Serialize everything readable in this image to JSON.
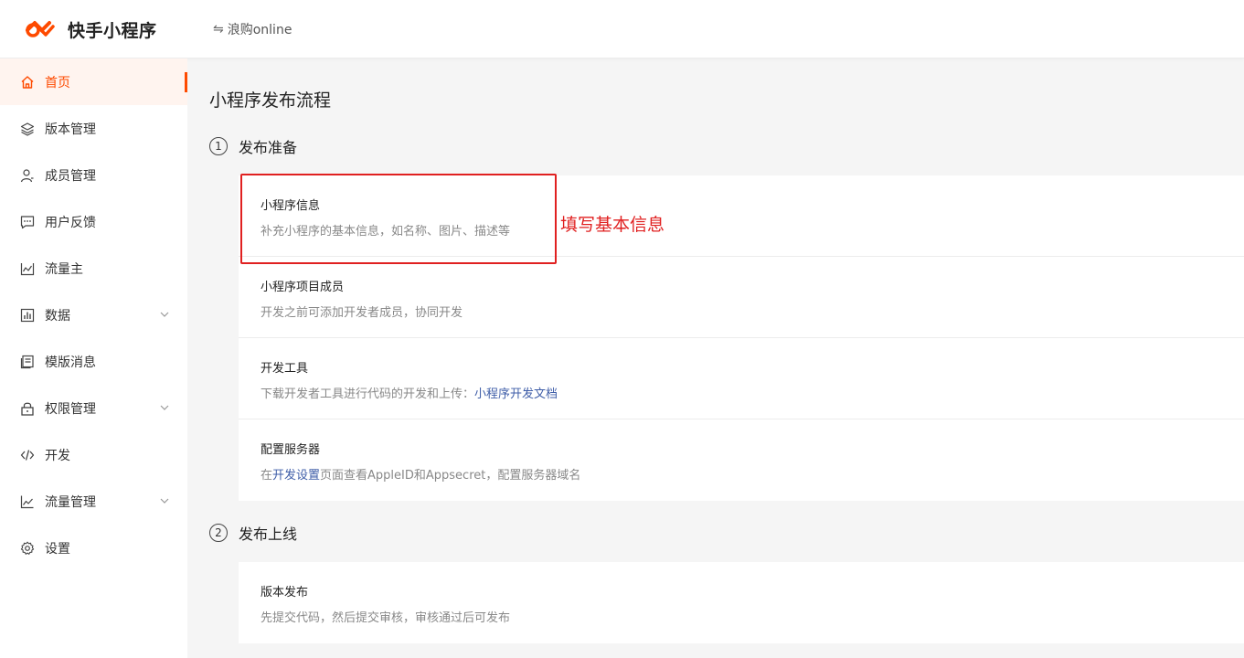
{
  "header": {
    "brand": "快手小程序",
    "app_name": "浪购online",
    "swap_icon": "⇋",
    "brand_color": "#fe4a00"
  },
  "sidebar": {
    "items": [
      {
        "label": "首页",
        "icon": "home-icon",
        "active": true
      },
      {
        "label": "版本管理",
        "icon": "layers-icon"
      },
      {
        "label": "成员管理",
        "icon": "user-icon"
      },
      {
        "label": "用户反馈",
        "icon": "message-icon"
      },
      {
        "label": "流量主",
        "icon": "traffic-icon"
      },
      {
        "label": "数据",
        "icon": "bar-chart-icon",
        "expandable": true
      },
      {
        "label": "模版消息",
        "icon": "document-icon"
      },
      {
        "label": "权限管理",
        "icon": "lock-icon",
        "expandable": true
      },
      {
        "label": "开发",
        "icon": "code-icon"
      },
      {
        "label": "流量管理",
        "icon": "line-chart-icon",
        "expandable": true
      },
      {
        "label": "设置",
        "icon": "gear-icon"
      }
    ]
  },
  "main": {
    "title": "小程序发布流程",
    "steps": [
      {
        "num": "1",
        "label": "发布准备",
        "items": [
          {
            "title": "小程序信息",
            "desc": "补充小程序的基本信息，如名称、图片、描述等"
          },
          {
            "title": "小程序项目成员",
            "desc": "开发之前可添加开发者成员，协同开发"
          },
          {
            "title": "开发工具",
            "desc_prefix": "下载开发者工具进行代码的开发和上传：",
            "desc_link": "小程序开发文档"
          },
          {
            "title": "配置服务器",
            "desc_prefix": "在",
            "desc_link": "开发设置",
            "desc_suffix": "页面查看AppleID和Appsecret，配置服务器域名"
          }
        ]
      },
      {
        "num": "2",
        "label": "发布上线",
        "items": [
          {
            "title": "版本发布",
            "desc": "先提交代码，然后提交审核，审核通过后可发布"
          }
        ]
      }
    ],
    "annotation": "填写基本信息",
    "annotation_color": "#e02020"
  }
}
